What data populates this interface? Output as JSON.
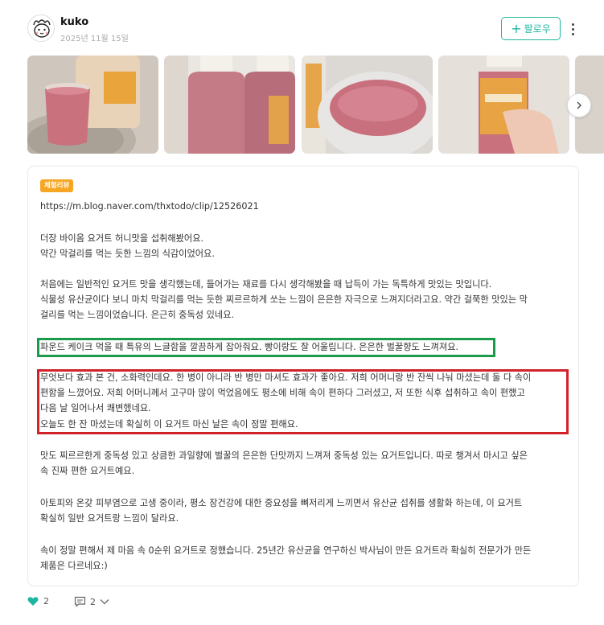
{
  "header": {
    "username": "kuko",
    "date": "2025년 11월 15일",
    "follow_label": "팔로우"
  },
  "gallery": {
    "images": [
      {
        "desc": "pink yogurt in glass on woven mat"
      },
      {
        "desc": "two yogurt bottles"
      },
      {
        "desc": "pink yogurt in glass close-up"
      },
      {
        "desc": "hand holding yogurt bottle"
      }
    ]
  },
  "post": {
    "badge": "체험리뷰",
    "url": "https://m.blog.naver.com/thxtodo/clip/12526021",
    "p1": "더장 바이옴 요거트 허니맛을 섭취해봤어요.\n약간 막걸리를 먹는 듯한 느낌의 식감이었어요.",
    "p2": "처음에는 일반적인 요거트 맛을 생각했는데, 들어가는 재료를 다시 생각해봤을 때 납득이 가는 독특하게 맛있는 맛입니다.\n식물성 유산균이다 보니 마치 막걸리를 먹는 듯한 찌르르하게 쏘는 느낌이 은은한 자극으로 느껴지더라고요. 약간 걸쭉한 맛있는 막\n걸리를 먹는 느낌이었습니다. 은근히 중독성 있네요.",
    "p3": "파운드 케이크 먹을 때 특유의 느글함을 깔끔하게 잡아줘요. 빵이랑도 잘 어울립니다. 은은한 벌꿀향도 느껴져요.",
    "p4": "무엇보다 효과 본 건, 소화력인데요. 한 병이 아니라 반 병만 마셔도 효과가 좋아요. 저희 어머니랑 반 잔씩 나눠 마셨는데 둘 다 속이\n편함을 느꼈어요. 저희 어머니께서 고구마 많이 먹었음에도 평소에 비해 속이 편하다 그러셨고, 저 또한 식후 섭취하고 속이 편했고\n다음 날 일어나서 쾌변했네요.\n오늘도 한 잔 마셨는데 확실히 이 요거트 마신 날은 속이 정말 편해요.",
    "p5": "맛도 찌르르한게 중독성 있고 상큼한 과일향에 벌꿀의 은은한 단맛까지 느껴져 중독성 있는 요거트입니다. 따로 챙겨서 마시고 싶은\n속 진짜 편한 요거트예요.",
    "p6": "아토피와 온갖 피부염으로 고생 중이라, 평소 장건강에 대한 중요성을 뼈저리게 느끼면서 유산균 섭취를 생활화 하는데, 이 요거트\n확실히 일반 요거트랑 느낌이 달라요.",
    "p7": "속이 정말 편해서 제 마음 속 0순위 요거트로 정했습니다. 25년간 유산균을 연구하신 박사님이 만든 요거트라 확실히 전문가가 만든\n제품은 다르네요:)"
  },
  "footer": {
    "like_count": "2",
    "comment_count": "2"
  },
  "colors": {
    "accent": "#1fb5a0",
    "badge": "#f5a623",
    "highlight_green": "#1a9a4a",
    "highlight_red": "#d2222a"
  }
}
